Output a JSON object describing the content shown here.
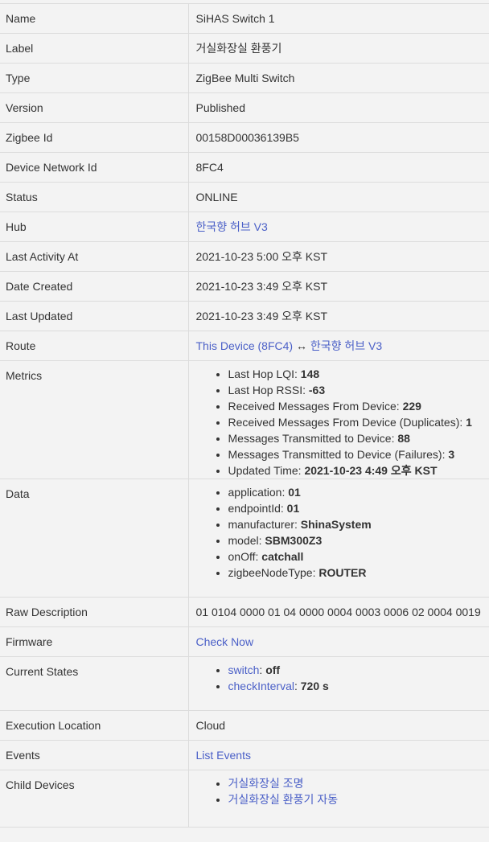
{
  "rows": {
    "name": {
      "key": "Name",
      "value": "SiHAS Switch 1"
    },
    "label": {
      "key": "Label",
      "value": "거실화장실 환풍기"
    },
    "type": {
      "key": "Type",
      "value": "ZigBee Multi Switch"
    },
    "version": {
      "key": "Version",
      "value": "Published"
    },
    "zigbee_id": {
      "key": "Zigbee Id",
      "value": "00158D00036139B5"
    },
    "network_id": {
      "key": "Device Network Id",
      "value": "8FC4"
    },
    "status": {
      "key": "Status",
      "value": "ONLINE"
    },
    "hub": {
      "key": "Hub",
      "value": "한국향 허브 V3"
    },
    "last_activity": {
      "key": "Last Activity At",
      "value": "2021-10-23 5:00 오후 KST"
    },
    "date_created": {
      "key": "Date Created",
      "value": "2021-10-23 3:49 오후 KST"
    },
    "last_updated": {
      "key": "Last Updated",
      "value": "2021-10-23 3:49 오후 KST"
    },
    "route": {
      "key": "Route",
      "device_link": "This Device (8FC4)",
      "arrow": " ↔ ",
      "hub_link": "한국향 허브 V3"
    },
    "metrics": {
      "key": "Metrics",
      "items": [
        {
          "label": "Last Hop LQI: ",
          "value": "148"
        },
        {
          "label": "Last Hop RSSI: ",
          "value": "-63"
        },
        {
          "label": "Received Messages From Device: ",
          "value": "229"
        },
        {
          "label": "Received Messages From Device (Duplicates): ",
          "value": "1"
        },
        {
          "label": "Messages Transmitted to Device: ",
          "value": "88"
        },
        {
          "label": "Messages Transmitted to Device (Failures): ",
          "value": "3"
        },
        {
          "label": "Updated Time: ",
          "value": "2021-10-23 4:49 오후 KST"
        }
      ]
    },
    "data": {
      "key": "Data",
      "items": [
        {
          "label": "application: ",
          "value": "01"
        },
        {
          "label": "endpointId: ",
          "value": "01"
        },
        {
          "label": "manufacturer: ",
          "value": "ShinaSystem"
        },
        {
          "label": "model: ",
          "value": "SBM300Z3"
        },
        {
          "label": "onOff: ",
          "value": "catchall"
        },
        {
          "label": "zigbeeNodeType: ",
          "value": "ROUTER"
        }
      ]
    },
    "raw_description": {
      "key": "Raw Description",
      "value": "01 0104 0000 01 04 0000 0004 0003 0006 02 0004 0019"
    },
    "firmware": {
      "key": "Firmware",
      "value": "Check Now"
    },
    "current_states": {
      "key": "Current States",
      "items": [
        {
          "label": "switch",
          "sep": ": ",
          "value": "off"
        },
        {
          "label": "checkInterval",
          "sep": ": ",
          "value": "720 s"
        }
      ]
    },
    "execution_location": {
      "key": "Execution Location",
      "value": "Cloud"
    },
    "events": {
      "key": "Events",
      "value": "List Events"
    },
    "child_devices": {
      "key": "Child Devices",
      "items": [
        "거실화장실 조명",
        "거실화장실 환풍기 자동"
      ]
    }
  }
}
